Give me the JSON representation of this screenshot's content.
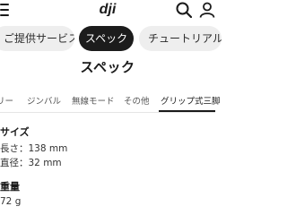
{
  "header": {
    "logo_text": "dji",
    "icons": [
      "menu-icon",
      "search-icon",
      "user-icon"
    ]
  },
  "nav_tabs": [
    {
      "label": "ご提供サービス",
      "active": false
    },
    {
      "label": "スペック",
      "active": true
    },
    {
      "label": "チュートリアル動",
      "active": false
    }
  ],
  "page": {
    "title": "スペック"
  },
  "sub_tabs": [
    {
      "label": "リー",
      "active": false
    },
    {
      "label": "ジンバル",
      "active": false
    },
    {
      "label": "無線モード",
      "active": false
    },
    {
      "label": "その他",
      "active": false
    },
    {
      "label": "グリップ式三脚",
      "active": true
    }
  ],
  "sections": [
    {
      "title": "サイズ",
      "rows": [
        "長さ：138 mm",
        "直径：32 mm"
      ]
    },
    {
      "title": "重量",
      "rows": [
        "72 g"
      ]
    }
  ],
  "colors": {
    "active_pill": "#1c1c1c",
    "inactive_pill": "#eeeeee",
    "text": "#1a1a1a"
  }
}
